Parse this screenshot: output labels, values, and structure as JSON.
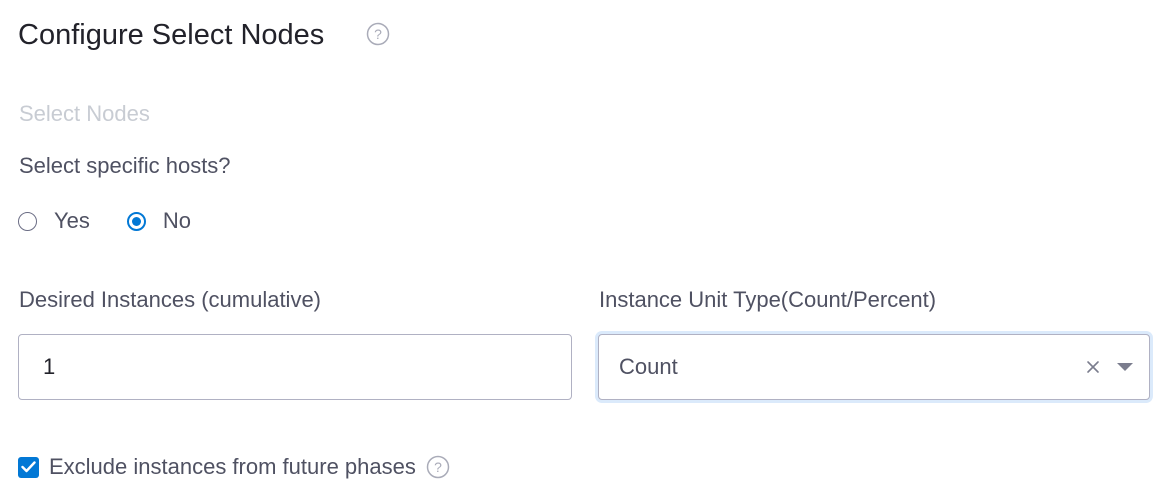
{
  "header": {
    "title": "Configure Select Nodes",
    "help_icon": "question-circle-icon"
  },
  "section": {
    "label": "Select Nodes"
  },
  "hosts": {
    "question": "Select specific hosts?",
    "options": [
      {
        "label": "Yes",
        "checked": false
      },
      {
        "label": "No",
        "checked": true
      }
    ]
  },
  "desired_instances": {
    "label": "Desired Instances (cumulative)",
    "value": "1"
  },
  "unit_type": {
    "label": "Instance Unit Type(Count/Percent)",
    "selected": "Count",
    "clear_icon": "close-icon",
    "caret_icon": "caret-down-icon"
  },
  "exclude": {
    "label": "Exclude instances from future phases",
    "checked": true,
    "help_icon": "question-circle-icon"
  },
  "colors": {
    "accent": "#0278d5",
    "text": "#4f5162",
    "title": "#22222a",
    "muted": "#c8ccd3",
    "border": "#b0b1c3",
    "focus_ring": "#dbeafb"
  }
}
